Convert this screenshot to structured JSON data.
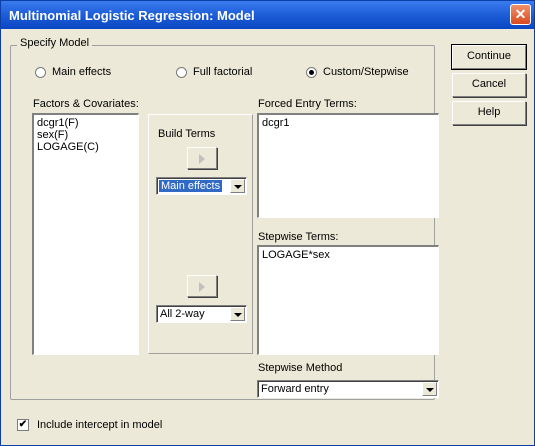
{
  "window": {
    "title": "Multinomial Logistic Regression: Model",
    "close_glyph": "✕"
  },
  "specify_model": {
    "label": "Specify Model",
    "options": [
      {
        "label": "Main effects",
        "selected": false
      },
      {
        "label": "Full factorial",
        "selected": false
      },
      {
        "label": "Custom/Stepwise",
        "selected": true
      }
    ]
  },
  "factors": {
    "label": "Factors & Covariates:",
    "items": [
      "dcgr1(F)",
      "sex(F)",
      "LOGAGE(C)"
    ]
  },
  "build_terms": {
    "label": "Build Terms",
    "forced_arrow_icon": "right-arrow-icon",
    "stepwise_arrow_icon": "right-arrow-icon",
    "term_type_value": "Main effects",
    "interaction_value": "All 2-way"
  },
  "forced_entry": {
    "label": "Forced Entry Terms:",
    "items": [
      "dcgr1"
    ]
  },
  "stepwise_terms": {
    "label": "Stepwise Terms:",
    "items": [
      "LOGAGE*sex"
    ]
  },
  "stepwise_method": {
    "label": "Stepwise Method",
    "value": "Forward entry"
  },
  "buttons": {
    "continue": "Continue",
    "cancel": "Cancel",
    "help": "Help"
  },
  "intercept": {
    "label": "Include intercept in model",
    "checked_glyph": "✔"
  }
}
